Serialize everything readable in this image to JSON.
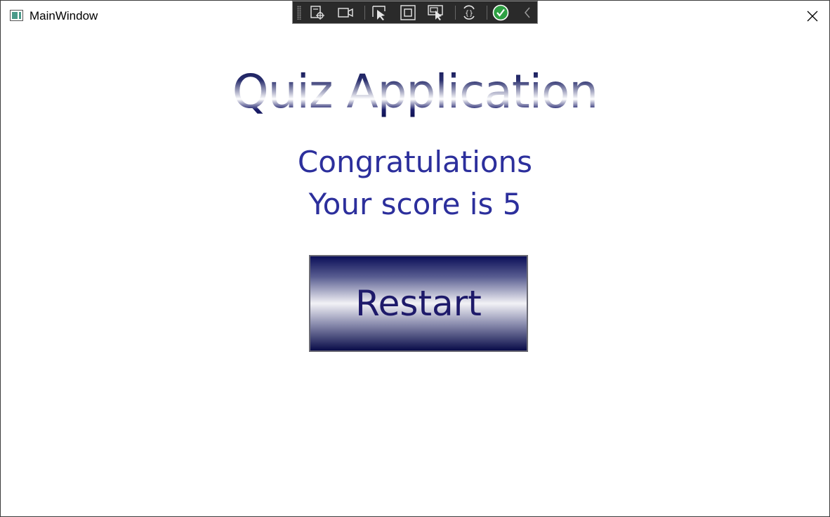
{
  "window": {
    "title": "MainWindow"
  },
  "debug_toolbar": {
    "buttons": [
      {
        "icon": "select-element-icon"
      },
      {
        "icon": "video-camera-icon"
      },
      {
        "icon": "pointer-select-icon"
      },
      {
        "icon": "layout-adorner-icon"
      },
      {
        "icon": "track-focus-icon"
      },
      {
        "icon": "hot-reload-icon"
      },
      {
        "icon": "check-circle-icon",
        "color": "#2ea043"
      },
      {
        "icon": "collapse-chevron-icon"
      }
    ]
  },
  "content": {
    "heading": "Quiz Application",
    "message_line1": "Congratulations",
    "message_line2": "Your score is 5",
    "restart_label": "Restart"
  },
  "colors": {
    "heading_dark": "#0c1050",
    "message_text": "#2c2f9c",
    "button_text": "#1e1a6a",
    "button_dark": "#0b0f58"
  }
}
